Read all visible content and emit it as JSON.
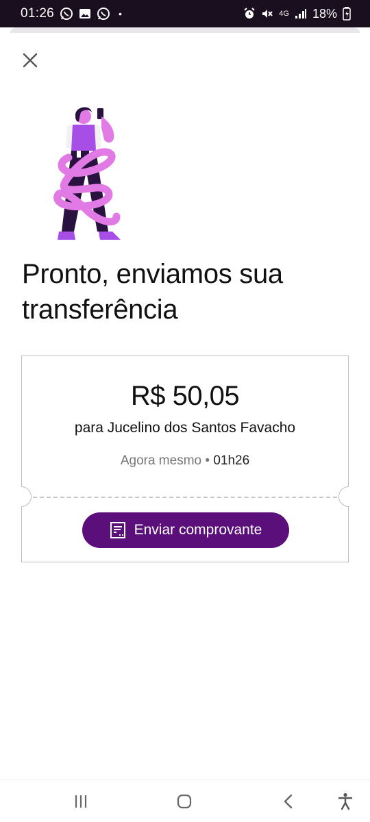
{
  "status_bar": {
    "time": "01:26",
    "dot": "•",
    "network": "4G",
    "battery": "18%",
    "icons_left": [
      "whatsapp-icon",
      "gallery-icon",
      "whatsapp-icon"
    ],
    "icons_right": [
      "alarm-icon",
      "mute-icon",
      "signal-icon",
      "battery-icon"
    ]
  },
  "header": {
    "close_icon": "close-icon"
  },
  "title": "Pronto, enviamos sua transferência",
  "receipt": {
    "amount": "R$ 50,05",
    "recipient": "para Jucelino dos Santos Favacho",
    "when_label": "Agora mesmo",
    "separator": "•",
    "time": "01h26",
    "button_label": "Enviar comprovante",
    "button_icon": "receipt-icon"
  },
  "colors": {
    "accent": "#5b0f7a",
    "status_bar_bg": "#1a0f1f",
    "illustration_purple": "#a64ee6",
    "illustration_pink": "#e27ae6",
    "illustration_dark": "#2a1240"
  },
  "nav": {
    "icons": [
      "recent-apps-icon",
      "home-icon",
      "back-icon",
      "accessibility-icon"
    ]
  }
}
